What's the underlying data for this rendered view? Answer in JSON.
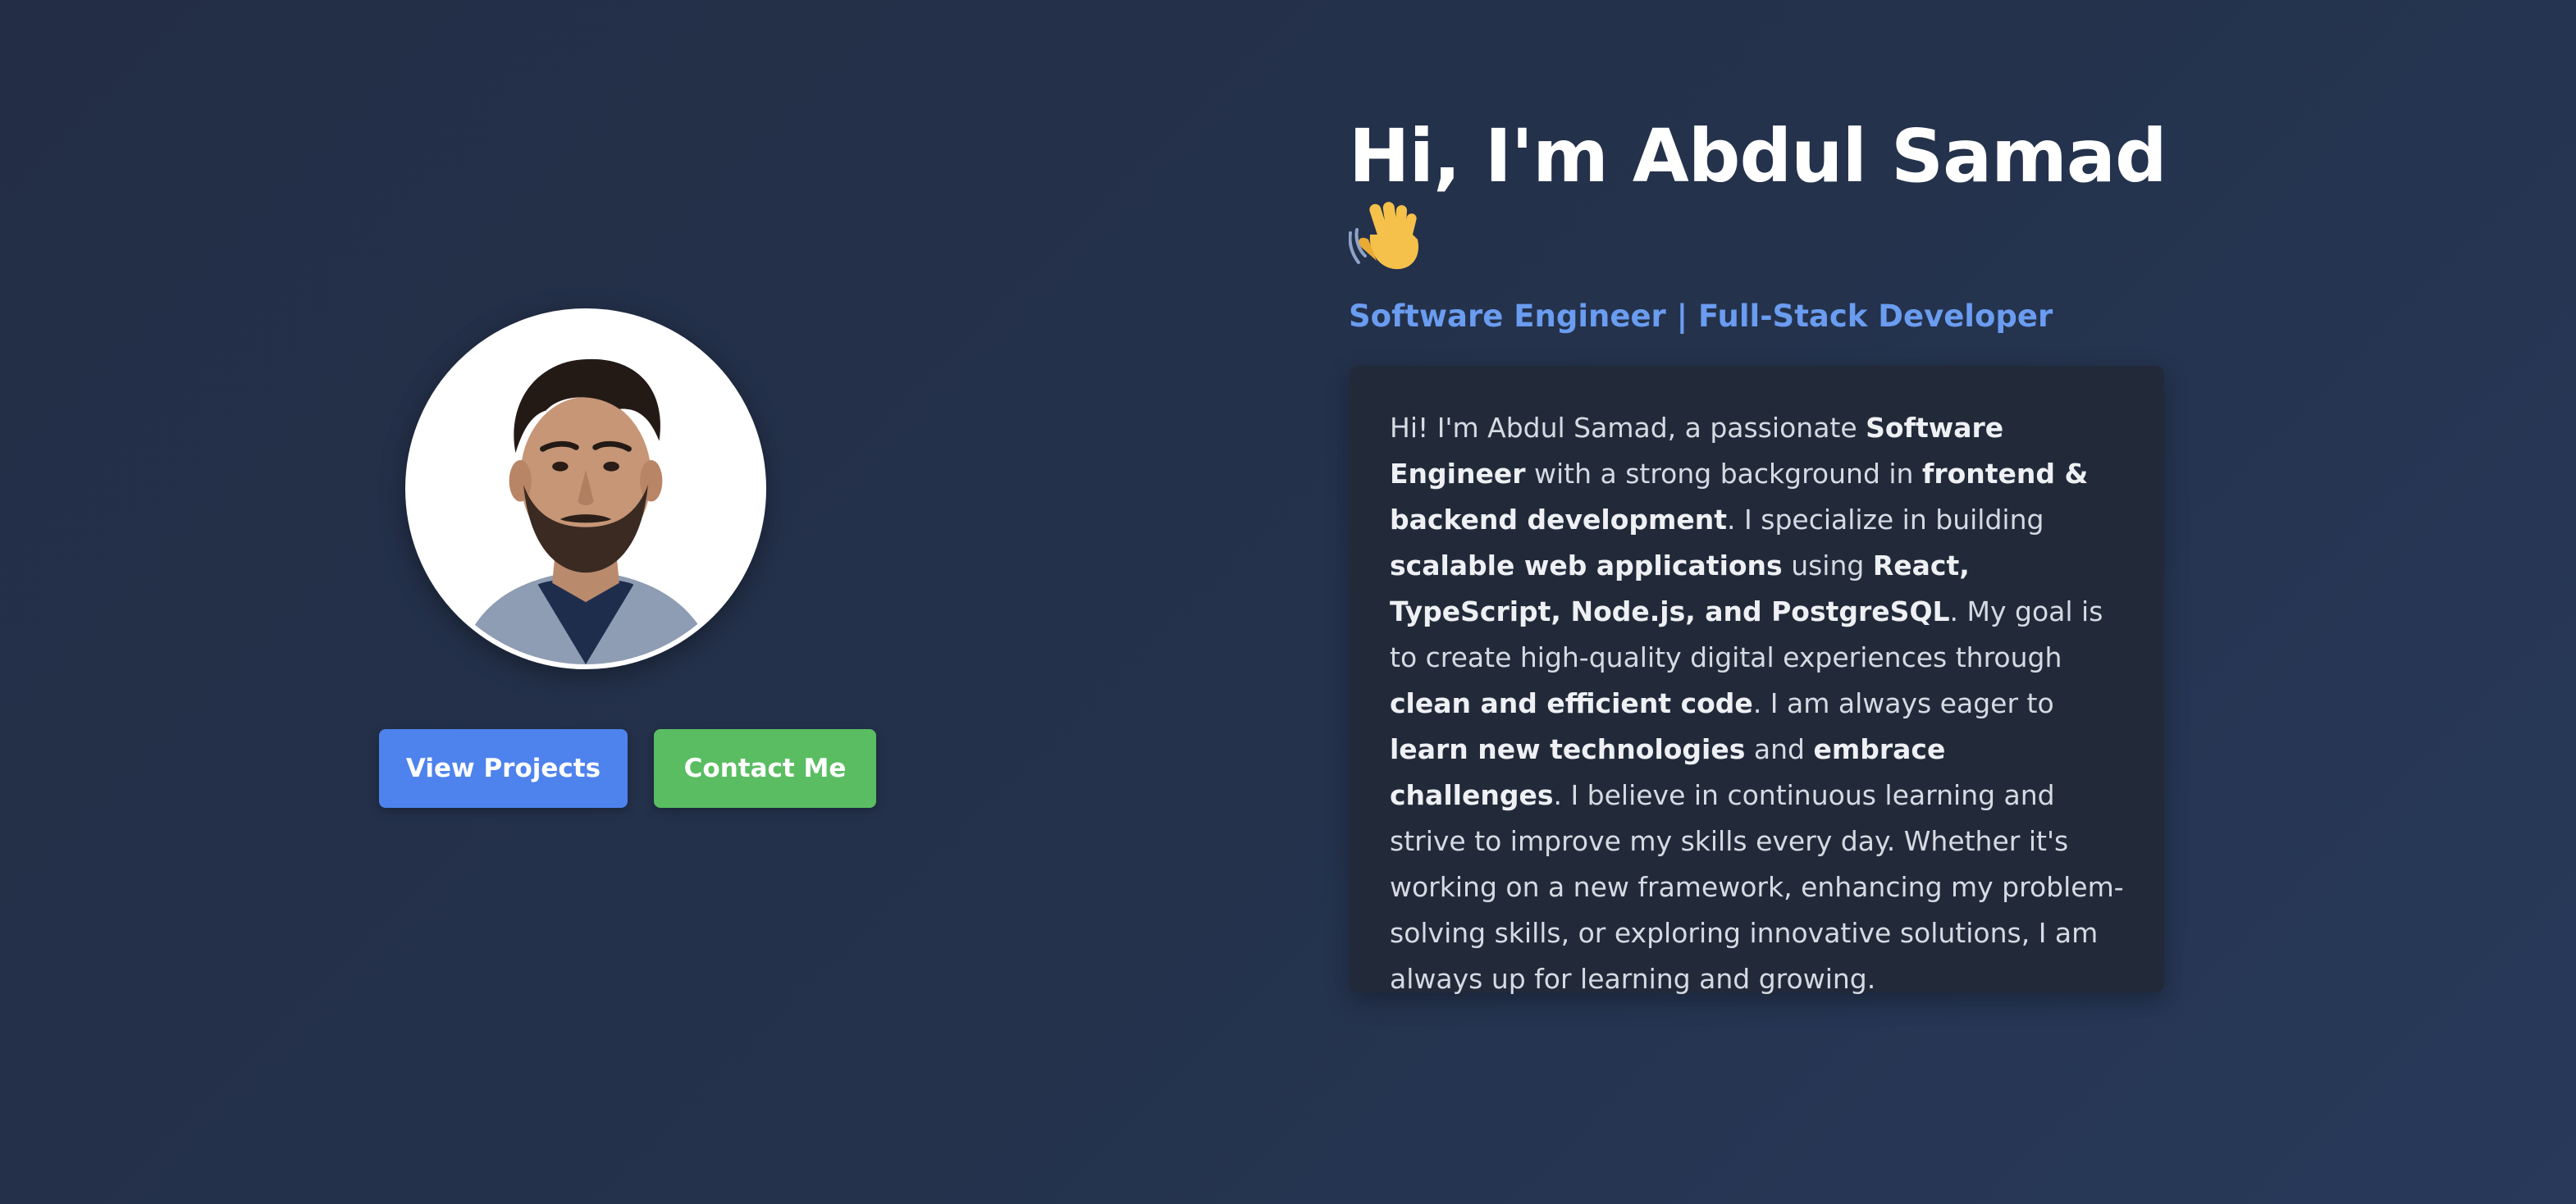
{
  "profile": {
    "photo_alt": "Abdul Samad"
  },
  "buttons": {
    "view_projects": "View Projects",
    "contact_me": "Contact Me"
  },
  "heading": {
    "title": "Hi, I'm Abdul Samad",
    "wave_emoji": "👋",
    "subtitle": "Software Engineer | Full-Stack Developer"
  },
  "bio": {
    "segments": [
      {
        "text": "Hi! I'm Abdul Samad, a passionate ",
        "bold": false
      },
      {
        "text": "Software Engineer",
        "bold": true
      },
      {
        "text": " with a strong background in ",
        "bold": false
      },
      {
        "text": "frontend & backend development",
        "bold": true
      },
      {
        "text": ". I specialize in building ",
        "bold": false
      },
      {
        "text": "scalable web applications",
        "bold": true
      },
      {
        "text": " using ",
        "bold": false
      },
      {
        "text": "React, TypeScript, Node.js, and PostgreSQL",
        "bold": true
      },
      {
        "text": ". My goal is to create high-quality digital experiences through ",
        "bold": false
      },
      {
        "text": "clean and efficient code",
        "bold": true
      },
      {
        "text": ". I am always eager to ",
        "bold": false
      },
      {
        "text": "learn new technologies",
        "bold": true
      },
      {
        "text": " and ",
        "bold": false
      },
      {
        "text": "embrace challenges",
        "bold": true
      },
      {
        "text": ". I believe in continuous learning and strive to improve my skills every day. Whether it's working on a new framework, enhancing my problem-solving skills, or exploring innovative solutions, I am always up for learning and growing.",
        "bold": false
      }
    ]
  },
  "colors": {
    "background": "#24324c",
    "card": "#222a3a",
    "accent_blue": "#4e83ed",
    "accent_green": "#5abd62",
    "subtitle": "#6a9cf0"
  }
}
